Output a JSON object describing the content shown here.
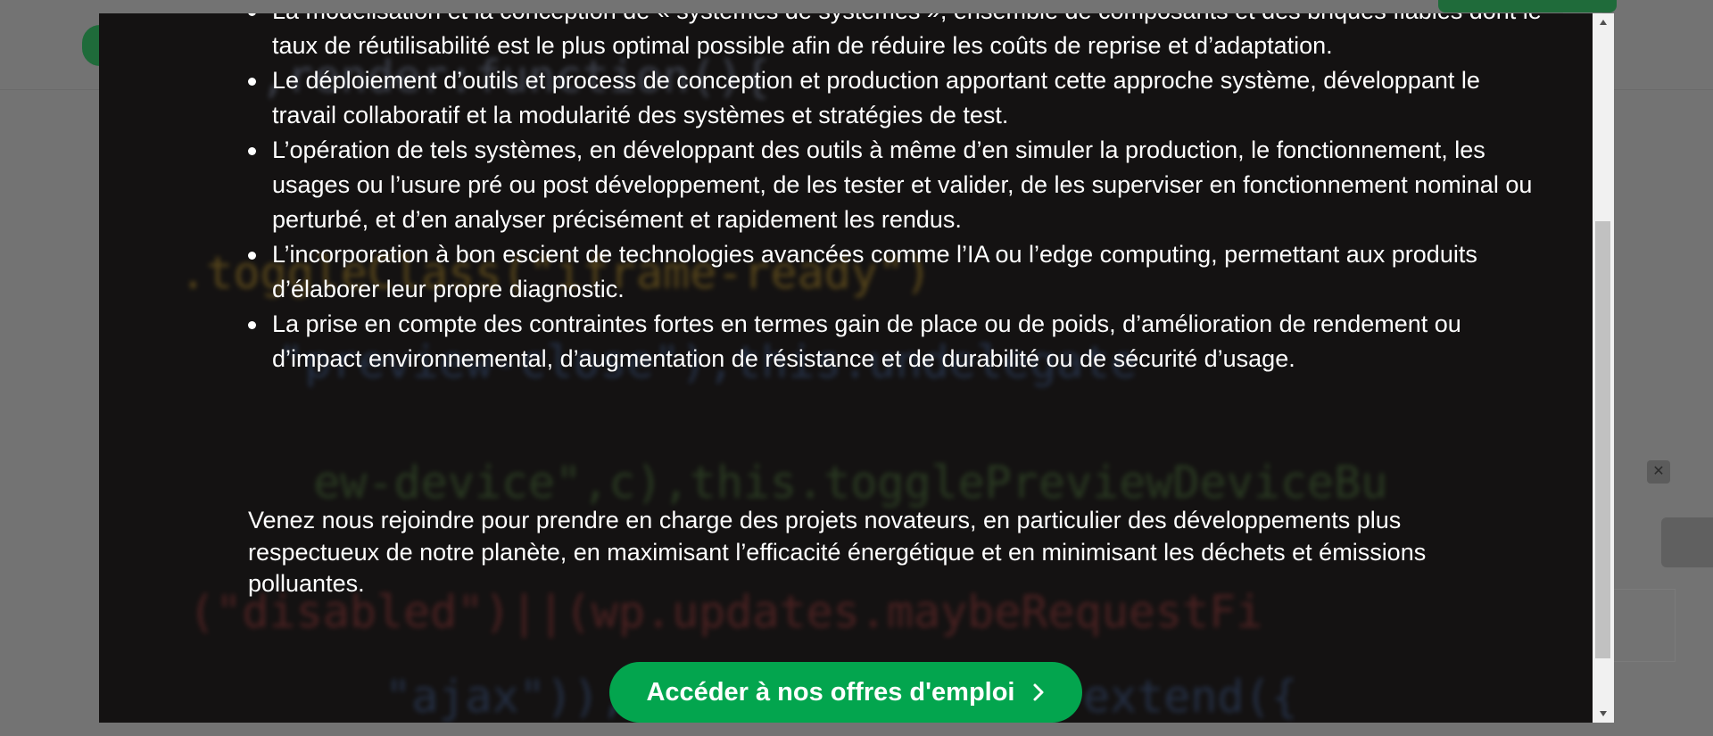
{
  "modal": {
    "bullets": [
      "La modélisation et la conception de « systèmes de systèmes », ensemble de composants et des briques fiables dont le taux de réutilisabilité est le plus optimal possible afin de réduire les coûts de reprise et d’adaptation.",
      "Le déploiement d’outils et process de conception et production apportant cette approche système, développant le travail collaboratif et la modularité des systèmes et stratégies de test.",
      "L’opération de tels systèmes, en développant des outils à même d’en simuler la production, le fonctionnement, les usages ou l’usure pré ou post développement, de les tester et valider, de les superviser en fonctionnement nominal ou perturbé, et d’en analyser précisément et rapidement les rendus.",
      "L’incorporation à bon escient de technologies avancées comme l’IA ou l’edge computing, permettant aux produits d’élaborer leur propre diagnostic.",
      "La prise en compte des contraintes fortes en termes gain de place ou de poids, d’amélioration de rendement ou d’impact environnemental, d’augmentation de résistance et de durabilité ou de sécurité d’usage."
    ],
    "closing_text": "Venez nous rejoindre pour prendre en charge des projets novateurs, en particulier des développements plus respectueux de notre planète, en maximisant l’efficacité énergétique et en minimisant les déchets et émissions polluantes.",
    "cta_label": "Accéder à nos offres d'emploi",
    "cta_icon": "chevron-right-icon",
    "accent_color": "#03a54e"
  },
  "scrollbar": {
    "up_icon": "scroll-up-arrow-icon",
    "down_icon": "scroll-down-arrow-icon",
    "scroll_position": 0.33
  },
  "background_code": [
    "  ,render:function(){",
    "  .toggleClass(\"iframe-ready\")",
    "  \"preview-close\"),this.undelegate",
    "  ew-device\",c),this.togglePreviewDeviceBu",
    "  (\"disabled\")||(wp.updates.maybeRequestFi",
    "  \"ajax\")),wp.Backbone.View.extend({"
  ]
}
